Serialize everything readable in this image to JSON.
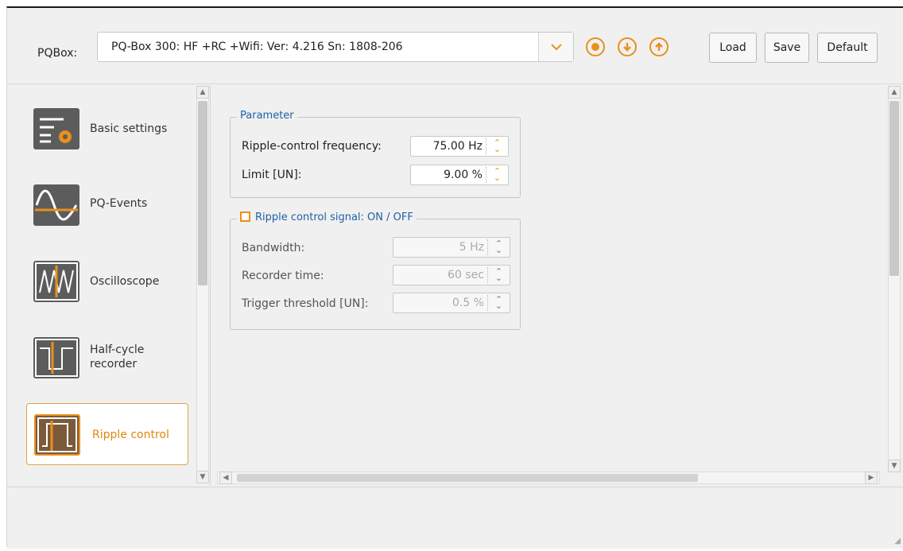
{
  "toolbar": {
    "device_label": "PQBox:",
    "device_value": "PQ-Box 300: HF +RC +Wifi: Ver: 4.216 Sn: 1808-206",
    "load_label": "Load",
    "save_label": "Save",
    "default_label": "Default",
    "icons": [
      "record-icon",
      "download-icon",
      "upload-icon"
    ],
    "accent_color": "#e8901c"
  },
  "sidebar": {
    "items": [
      {
        "label": "Basic settings",
        "icon": "basic-settings-icon",
        "active": false
      },
      {
        "label": "PQ-Events",
        "icon": "pq-events-icon",
        "active": false
      },
      {
        "label": "Oscilloscope",
        "icon": "oscilloscope-icon",
        "active": false
      },
      {
        "label": "Half-cycle recorder",
        "icon": "half-cycle-recorder-icon",
        "active": false
      },
      {
        "label": "Ripple control",
        "icon": "ripple-control-icon",
        "active": true
      }
    ]
  },
  "parameter_group": {
    "title": "Parameter",
    "frequency_label": "Ripple-control frequency:",
    "frequency_value": "75.00 Hz",
    "limit_label": "Limit [UN]:",
    "limit_value": "9.00 %"
  },
  "signal_group": {
    "title": "Ripple control signal:  ON / OFF",
    "checked": false,
    "bandwidth_label": "Bandwidth:",
    "bandwidth_value": "5 Hz",
    "recorder_label": "Recorder time:",
    "recorder_value": "60 sec",
    "trigger_label": "Trigger threshold [UN]:",
    "trigger_value": "0.5 %"
  },
  "colors": {
    "accent": "#e8901c",
    "group_title": "#1f5fa6"
  }
}
